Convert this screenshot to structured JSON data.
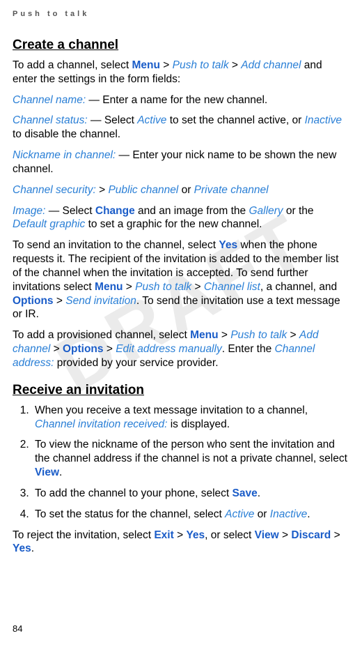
{
  "page_header": "Push to talk",
  "watermark": "DRAFT",
  "page_number": "84",
  "section1": {
    "title": "Create a channel",
    "p1": {
      "prefix": "To add a channel, select ",
      "m1": "Menu",
      "sep": " > ",
      "m2": "Push to talk",
      "m3": "Add channel",
      "suffix": " and enter the settings in the form fields:"
    },
    "p2": {
      "label": "Channel name:",
      "text": " — Enter a name for the new channel."
    },
    "p3": {
      "label": "Channel status:",
      "prefix": " — Select ",
      "o1": "Active",
      "mid": " to set the channel active, or ",
      "o2": "Inactive",
      "suffix": " to disable the channel."
    },
    "p4": {
      "label": "Nickname in channel:",
      "text": " — Enter your nick name to be shown the new channel."
    },
    "p5": {
      "label": "Channel security:",
      "sep": "  > ",
      "o1": "Public channel",
      "or": " or ",
      "o2": "Private channel"
    },
    "p6": {
      "label": "Image:",
      "prefix": " — Select ",
      "b1": "Change",
      "mid1": " and an image from the ",
      "o1": "Gallery",
      "mid2": " or the ",
      "o2": "Default graphic",
      "suffix": " to set a graphic for the new channel."
    },
    "p7": {
      "t1": "To send an invitation to the channel, select ",
      "b1": "Yes",
      "t2": " when the phone requests it. The recipient of the invitation is added to the member list of the channel when the invitation is accepted. To send further invitations select ",
      "m1": "Menu",
      "sep": " > ",
      "m2": "Push to talk",
      "m3": "Channel list",
      "t3": ", a channel, and ",
      "m4": "Options",
      "m5": "Send invitation",
      "t4": ". To send the invitation use a text message or IR."
    },
    "p8": {
      "t1": "To add a provisioned channel, select ",
      "m1": "Menu",
      "sep": " > ",
      "m2": "Push to talk",
      "m3": "Add channel",
      "m4": "Options",
      "m5": "Edit address manually",
      "t2": ". Enter the ",
      "o1": "Channel address:",
      "t3": " provided by your service provider."
    }
  },
  "section2": {
    "title": "Receive an invitation",
    "li1": {
      "t1": "When you receive a text message invitation to a channel, ",
      "o1": "Channel invitation received:",
      "t2": " is displayed."
    },
    "li2": {
      "t1": "To view the nickname of the person who sent the invitation and the channel address if the channel is not a private channel, select ",
      "b1": "View",
      "t2": "."
    },
    "li3": {
      "t1": "To add the channel to your phone, select ",
      "b1": "Save",
      "t2": "."
    },
    "li4": {
      "t1": "To set the status for the channel, select ",
      "o1": "Active",
      "or": " or ",
      "o2": "Inactive",
      "t2": "."
    },
    "p_reject": {
      "t1": "To reject the invitation, select ",
      "b1": "Exit",
      "sep": " > ",
      "b2": "Yes",
      "t2": ", or select ",
      "b3": "View",
      "b4": "Discard",
      "b5": "Yes",
      "t3": "."
    }
  }
}
